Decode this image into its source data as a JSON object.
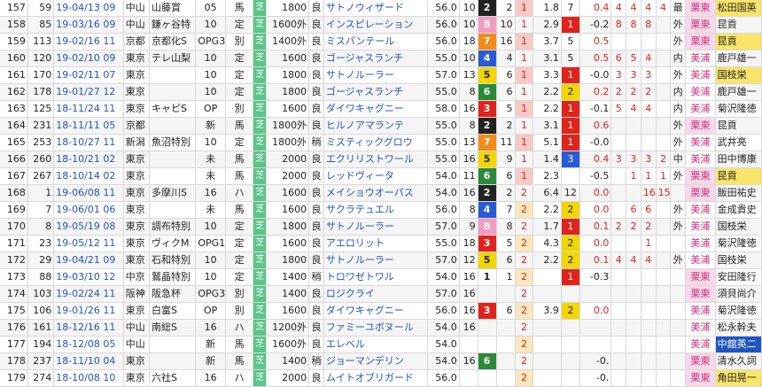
{
  "gate_colors": {
    "1": "#ffffff",
    "2": "#222222",
    "3": "#e0231c",
    "4": "#2a5bd7",
    "5": "#f2d600",
    "6": "#2a8a3a",
    "7": "#f28c1a",
    "8": "#f29cc3"
  },
  "rows": [
    {
      "n": "157",
      "idx": "59",
      "date": "19-04/13 09",
      "place": "中山",
      "race": "山藤賞",
      "cls": "05",
      "cond": "馬",
      "dist": "1800",
      "going": "良",
      "horse": "サトノウィザード",
      "w": "56.0",
      "h": "10",
      "g": "2",
      "p": "2",
      "pos": "1",
      "o": "1.8",
      "r": "7",
      "d": "0.4",
      "a": "4",
      "b": "4",
      "c": "4",
      "e": "4",
      "aff": "最",
      "jock": "栗東",
      "trainer": "松田国英"
    },
    {
      "n": "158",
      "idx": "85",
      "date": "19-03/16 09",
      "place": "中山",
      "race": "鎌ヶ谷特",
      "cls": "10",
      "cond": "定",
      "dist": "1600外",
      "going": "良",
      "horse": "インスピレーション",
      "w": "56.0",
      "h": "10",
      "g": "8",
      "p": "10",
      "pos": "1",
      "o": "2.9",
      "r": "1",
      "d": "-0.2",
      "a": "8",
      "b": "8",
      "c": "8",
      "e": "",
      "aff": "外",
      "jock": "栗東",
      "trainer": "昆貢"
    },
    {
      "n": "159",
      "idx": "113",
      "date": "19-02/16 11",
      "place": "京都",
      "race": "京都化S",
      "cls": "OPG3",
      "cond": "別",
      "dist": "1400外",
      "going": "良",
      "horse": "ミスパンテール",
      "w": "56.0",
      "h": "18",
      "g": "7",
      "p": "16",
      "pos": "1",
      "o": "3.7",
      "r": "5",
      "d": "0.5",
      "a": "",
      "b": "",
      "c": "",
      "e": "",
      "aff": "外",
      "jock": "栗東",
      "trainer": "昆貢"
    },
    {
      "n": "160",
      "idx": "120",
      "date": "19-02/10 09",
      "place": "東京",
      "race": "テレ山梨",
      "cls": "10",
      "cond": "定",
      "dist": "1600",
      "going": "良",
      "horse": "ゴージャスランチ",
      "w": "55.0",
      "h": "10",
      "g": "4",
      "p": "4",
      "pos": "1",
      "o": "3.1",
      "r": "5",
      "d": "0.5",
      "a": "6",
      "b": "5",
      "c": "4",
      "e": "",
      "aff": "内",
      "jock": "美浦",
      "trainer": "鹿戸雄一"
    },
    {
      "n": "161",
      "idx": "170",
      "date": "19-02/11 07",
      "place": "東京",
      "race": "",
      "cls": "10",
      "cond": "定",
      "dist": "1800",
      "going": "良",
      "horse": "サトノルーラー",
      "w": "57.0",
      "h": "13",
      "g": "5",
      "p": "6",
      "pos": "1",
      "o": "3.3",
      "r": "1",
      "d": "-0.0",
      "a": "3",
      "b": "3",
      "c": "3",
      "e": "",
      "aff": "外",
      "jock": "美浦",
      "trainer": "国枝栄"
    },
    {
      "n": "162",
      "idx": "178",
      "date": "19-01/27 12",
      "place": "東京",
      "race": "",
      "cls": "10",
      "cond": "定",
      "dist": "1800",
      "going": "良",
      "horse": "ゴージャスランチ",
      "w": "55.0",
      "h": "8",
      "g": "6",
      "p": "6",
      "pos": "1",
      "o": "2.2",
      "r": "2",
      "d": "0.2",
      "a": "2",
      "b": "2",
      "c": "2",
      "e": "",
      "aff": "内",
      "jock": "美浦",
      "trainer": "鹿戸雄一"
    },
    {
      "n": "163",
      "idx": "125",
      "date": "18-11/24 11",
      "place": "東京",
      "race": "キャピS",
      "cls": "OP",
      "cond": "別",
      "dist": "1600",
      "going": "良",
      "horse": "ダイワキャグニー",
      "w": "58.0",
      "h": "16",
      "g": "3",
      "p": "5",
      "pos": "1",
      "o": "2.2",
      "r": "1",
      "d": "-0.1",
      "a": "5",
      "b": "4",
      "c": "4",
      "e": "",
      "aff": "内",
      "jock": "美浦",
      "trainer": "菊沢隆徳"
    },
    {
      "n": "164",
      "idx": "231",
      "date": "18-11/11 05",
      "place": "京都",
      "race": "",
      "cls": "新",
      "cond": "馬",
      "dist": "1800外",
      "going": "良",
      "horse": "ヒルノアマランテ",
      "w": "55.0",
      "h": "8",
      "g": "2",
      "p": "2",
      "pos": "1",
      "o": "3.1",
      "r": "1",
      "d": "0.6",
      "a": "",
      "b": "",
      "c": "",
      "e": "",
      "aff": "外",
      "jock": "栗東",
      "trainer": "昆貢"
    },
    {
      "n": "165",
      "idx": "253",
      "date": "18-10/27 11",
      "place": "新潟",
      "race": "魚沼特別",
      "cls": "10",
      "cond": "定",
      "dist": "1800外",
      "going": "稍",
      "horse": "ミスティックグロウ",
      "w": "55.0",
      "h": "13",
      "g": "7",
      "p": "11",
      "pos": "1",
      "o": "5.1",
      "r": "1",
      "d": "-0.0",
      "a": "",
      "b": "",
      "c": "",
      "e": "",
      "aff": "外",
      "jock": "美浦",
      "trainer": "武井亮"
    },
    {
      "n": "166",
      "idx": "260",
      "date": "18-10/21 02",
      "place": "東京",
      "race": "",
      "cls": "未",
      "cond": "馬",
      "dist": "2000",
      "going": "良",
      "horse": "エクリリストワール",
      "w": "55.0",
      "h": "16",
      "g": "5",
      "p": "9",
      "pos": "1",
      "o": "1.4",
      "r": "3",
      "d": "0.4",
      "a": "3",
      "b": "3",
      "c": "3",
      "e": "2",
      "aff": "中",
      "jock": "美浦",
      "trainer": "田中博康"
    },
    {
      "n": "167",
      "idx": "267",
      "date": "18-10/14 02",
      "place": "東京",
      "race": "",
      "cls": "未",
      "cond": "馬",
      "dist": "2000",
      "going": "良",
      "horse": "レッドヴィータ",
      "w": "54.0",
      "h": "11",
      "g": "6",
      "p": "6",
      "pos": "1",
      "o": "2.3",
      "r": "",
      "d": "-0.5",
      "a": "",
      "b": "1",
      "c": "1",
      "e": "1",
      "aff": "外",
      "jock": "栗東",
      "trainer": "昆貢"
    },
    {
      "n": "168",
      "idx": "1",
      "date": "19-06/08 11",
      "place": "東京",
      "race": "多摩川S",
      "cls": "16",
      "cond": "ハ",
      "dist": "1600",
      "going": "良",
      "horse": "メイショウオーパス",
      "w": "54.0",
      "h": "16",
      "g": "2",
      "p": "2",
      "pos": "2",
      "o": "6.4",
      "r": "12",
      "d": "0.0",
      "a": "",
      "b": "",
      "c": "16",
      "e": "15",
      "aff": "",
      "jock": "栗東",
      "trainer": "飯田祐史"
    },
    {
      "n": "169",
      "idx": "7",
      "date": "19-06/01 06",
      "place": "東京",
      "race": "",
      "cls": "未",
      "cond": "馬",
      "dist": "1600",
      "going": "良",
      "horse": "サクラテュエル",
      "w": "56.0",
      "h": "8",
      "g": "4",
      "p": "7",
      "pos": "2",
      "o": "2.2",
      "r": "2",
      "d": "0.0",
      "a": "",
      "b": "6",
      "c": "6",
      "e": "",
      "aff": "外",
      "jock": "美浦",
      "trainer": "金成貴史"
    },
    {
      "n": "170",
      "idx": "8",
      "date": "19-05/19 08",
      "place": "東京",
      "race": "調布特別",
      "cls": "10",
      "cond": "定",
      "dist": "1800",
      "going": "良",
      "horse": "サトノルーラー",
      "w": "57.0",
      "h": "9",
      "g": "8",
      "p": "8",
      "pos": "2",
      "o": "1.7",
      "r": "1",
      "d": "0.1",
      "a": "2",
      "b": "2",
      "c": "2",
      "e": "",
      "aff": "外",
      "jock": "美浦",
      "trainer": "国枝栄"
    },
    {
      "n": "171",
      "idx": "23",
      "date": "19-05/12 11",
      "place": "東京",
      "race": "ヴィクM",
      "cls": "OPG1",
      "cond": "定",
      "dist": "1600",
      "going": "良",
      "horse": "アエロリット",
      "w": "55.0",
      "h": "18",
      "g": "3",
      "p": "5",
      "pos": "2",
      "o": "4.3",
      "r": "2",
      "d": "0.0",
      "a": "",
      "b": "",
      "c": "1",
      "e": "",
      "aff": "",
      "jock": "美浦",
      "trainer": "菊沢隆徳"
    },
    {
      "n": "172",
      "idx": "29",
      "date": "19-04/21 09",
      "place": "東京",
      "race": "石和特別",
      "cls": "10",
      "cond": "定",
      "dist": "1800",
      "going": "良",
      "horse": "サトノルーラー",
      "w": "57.0",
      "h": "12",
      "g": "5",
      "p": "6",
      "pos": "2",
      "o": "2.2",
      "r": "2",
      "d": "0.1",
      "a": "4",
      "b": "4",
      "c": "4",
      "e": "",
      "aff": "外",
      "jock": "美浦",
      "trainer": "国枝栄"
    },
    {
      "n": "173",
      "idx": "88",
      "date": "19-03/10 12",
      "place": "中京",
      "race": "鷲晶特別",
      "cls": "10",
      "cond": "定",
      "dist": "1400",
      "going": "稍",
      "horse": "トロワゼトワル",
      "w": "54.0",
      "h": "16",
      "g": "1",
      "p": "1",
      "pos": "2",
      "o": "",
      "r": "1",
      "d": "-0.3",
      "a": "",
      "b": "",
      "c": "",
      "e": "",
      "aff": "",
      "jock": "栗東",
      "trainer": "安田隆行"
    },
    {
      "n": "174",
      "idx": "103",
      "date": "19-02/24 11",
      "place": "阪神",
      "race": "阪急杯",
      "cls": "OPG3",
      "cond": "別",
      "dist": "1400",
      "going": "良",
      "horse": "ロジクライ",
      "w": "57.0",
      "h": "16",
      "g": "",
      "p": "",
      "pos": "2",
      "o": "",
      "r": "",
      "d": "",
      "a": "",
      "b": "",
      "c": "",
      "e": "",
      "aff": "",
      "jock": "栗東",
      "trainer": "須貝尚介"
    },
    {
      "n": "175",
      "idx": "106",
      "date": "19-01/26 11",
      "place": "東京",
      "race": "白富S",
      "cls": "OP",
      "cond": "別",
      "dist": "1600",
      "going": "良",
      "horse": "ダイワキャグニー",
      "w": "56.0",
      "h": "16",
      "g": "3",
      "p": "6",
      "pos": "2",
      "o": "3.9",
      "r": "2",
      "d": "0.0",
      "a": "",
      "b": "",
      "c": "",
      "e": "",
      "aff": "",
      "jock": "美浦",
      "trainer": "菊沢隆徳"
    },
    {
      "n": "176",
      "idx": "161",
      "date": "18-12/16 11",
      "place": "中山",
      "race": "南総S",
      "cls": "16",
      "cond": "ハ",
      "dist": "1200外",
      "going": "良",
      "horse": "ファミーユボヌール",
      "w": "54.0",
      "h": "16",
      "g": "",
      "p": "",
      "pos": "2",
      "o": "",
      "r": "",
      "d": "",
      "a": "",
      "b": "",
      "c": "",
      "e": "",
      "aff": "",
      "jock": "美浦",
      "trainer": "松永幹夫"
    },
    {
      "n": "177",
      "idx": "194",
      "date": "18-12/08 05",
      "place": "中山",
      "race": "",
      "cls": "新",
      "cond": "馬",
      "dist": "1600外",
      "going": "良",
      "horse": "エレベル",
      "w": "54.0",
      "h": "",
      "g": "",
      "p": "",
      "pos": "2",
      "o": "",
      "r": "",
      "d": "",
      "a": "",
      "b": "",
      "c": "",
      "e": "",
      "aff": "",
      "jock": "美浦",
      "trainer": "中舘英二"
    },
    {
      "n": "178",
      "idx": "237",
      "date": "18-11/10 04",
      "place": "東京",
      "race": "",
      "cls": "新",
      "cond": "馬",
      "dist": "1400",
      "going": "稍",
      "horse": "ジョーマンデリン",
      "w": "54.0",
      "h": "16",
      "g": "6",
      "p": "",
      "pos": "2",
      "o": "",
      "r": "",
      "d": "-0.",
      "a": "",
      "b": "",
      "c": "",
      "e": "",
      "aff": "",
      "jock": "栗東",
      "trainer": "清水久詞"
    },
    {
      "n": "179",
      "idx": "274",
      "date": "18-10/08 10",
      "place": "東京",
      "race": "六社S",
      "cls": "16",
      "cond": "ハ",
      "dist": "2000",
      "going": "良",
      "horse": "ムイトオブリガード",
      "w": "56.0",
      "h": "",
      "g": "",
      "p": "",
      "pos": "2",
      "o": "",
      "r": "",
      "d": "-0.",
      "a": "",
      "b": "",
      "c": "",
      "e": "",
      "aff": "",
      "jock": "栗東",
      "trainer": "角田晃一"
    }
  ]
}
